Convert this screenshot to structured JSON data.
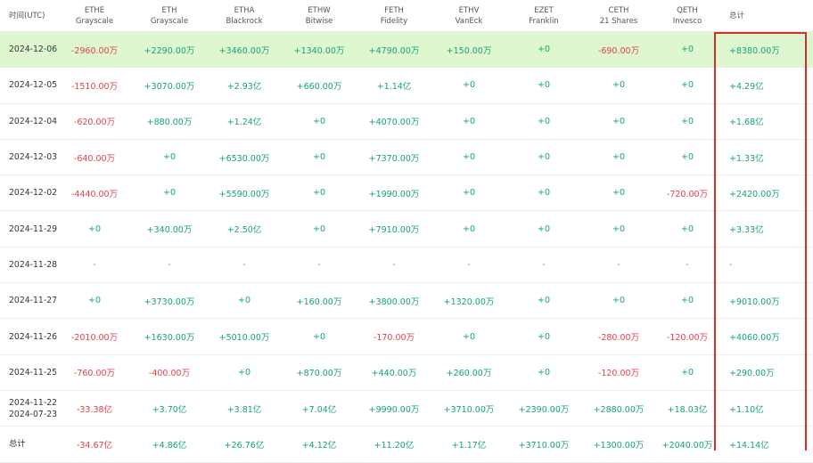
{
  "columns": [
    {
      "code": "时间(UTC)",
      "issuer": ""
    },
    {
      "code": "ETHE",
      "issuer": "Grayscale"
    },
    {
      "code": "ETH",
      "issuer": "Grayscale"
    },
    {
      "code": "ETHA",
      "issuer": "Blackrock"
    },
    {
      "code": "ETHW",
      "issuer": "Bitwise"
    },
    {
      "code": "FETH",
      "issuer": "Fidelity"
    },
    {
      "code": "ETHV",
      "issuer": "VanEck"
    },
    {
      "code": "EZET",
      "issuer": "Franklin"
    },
    {
      "code": "CETH",
      "issuer": "21 Shares"
    },
    {
      "code": "QETH",
      "issuer": "Invesco"
    },
    {
      "code": "总计",
      "issuer": ""
    }
  ],
  "rows": [
    {
      "date": [
        "2024-12-06"
      ],
      "highlight": true,
      "values": [
        "-2960.00万",
        "+2290.00万",
        "+3460.00万",
        "+1340.00万",
        "+4790.00万",
        "+150.00万",
        "+0",
        "-690.00万",
        "+0",
        "+8380.00万"
      ]
    },
    {
      "date": [
        "2024-12-05"
      ],
      "values": [
        "-1510.00万",
        "+3070.00万",
        "+2.93亿",
        "+660.00万",
        "+1.14亿",
        "+0",
        "+0",
        "+0",
        "+0",
        "+4.29亿"
      ]
    },
    {
      "date": [
        "2024-12-04"
      ],
      "values": [
        "-620.00万",
        "+880.00万",
        "+1.24亿",
        "+0",
        "+4070.00万",
        "+0",
        "+0",
        "+0",
        "+0",
        "+1.68亿"
      ]
    },
    {
      "date": [
        "2024-12-03"
      ],
      "values": [
        "-640.00万",
        "+0",
        "+6530.00万",
        "+0",
        "+7370.00万",
        "+0",
        "+0",
        "+0",
        "+0",
        "+1.33亿"
      ]
    },
    {
      "date": [
        "2024-12-02"
      ],
      "values": [
        "-4440.00万",
        "+0",
        "+5590.00万",
        "+0",
        "+1990.00万",
        "+0",
        "+0",
        "+0",
        "-720.00万",
        "+2420.00万"
      ]
    },
    {
      "date": [
        "2024-11-29"
      ],
      "values": [
        "+0",
        "+340.00万",
        "+2.50亿",
        "+0",
        "+7910.00万",
        "+0",
        "+0",
        "+0",
        "+0",
        "+3.33亿"
      ]
    },
    {
      "date": [
        "2024-11-28"
      ],
      "values": [
        "-",
        "-",
        "-",
        "-",
        "-",
        "-",
        "-",
        "-",
        "-",
        "-"
      ]
    },
    {
      "date": [
        "2024-11-27"
      ],
      "values": [
        "+0",
        "+3730.00万",
        "+0",
        "+160.00万",
        "+3800.00万",
        "+1320.00万",
        "+0",
        "+0",
        "+0",
        "+9010.00万"
      ]
    },
    {
      "date": [
        "2024-11-26"
      ],
      "values": [
        "-2010.00万",
        "+1630.00万",
        "+5010.00万",
        "+0",
        "-170.00万",
        "+0",
        "+0",
        "-280.00万",
        "-120.00万",
        "+4060.00万"
      ]
    },
    {
      "date": [
        "2024-11-25"
      ],
      "values": [
        "-760.00万",
        "-400.00万",
        "+0",
        "+870.00万",
        "+440.00万",
        "+260.00万",
        "+0",
        "-120.00万",
        "+0",
        "+290.00万"
      ]
    },
    {
      "date": [
        "2024-11-22",
        "2024-07-23"
      ],
      "values": [
        "-33.38亿",
        "+3.70亿",
        "+3.81亿",
        "+7.04亿",
        "+9990.00万",
        "+3710.00万",
        "+2390.00万",
        "+2880.00万",
        "+18.03亿",
        "+1.10亿"
      ]
    },
    {
      "date": [
        "总计"
      ],
      "values": [
        "-34.67亿",
        "+4.86亿",
        "+26.76亿",
        "+4.12亿",
        "+11.20亿",
        "+1.17亿",
        "+3710.00万",
        "+1300.00万",
        "+2040.00万",
        "+14.14亿"
      ]
    }
  ],
  "colors": {
    "positive": "#14a37a",
    "negative": "#e0424b",
    "highlight_row": "#dff7cf",
    "total_box": "#d72f2a"
  }
}
